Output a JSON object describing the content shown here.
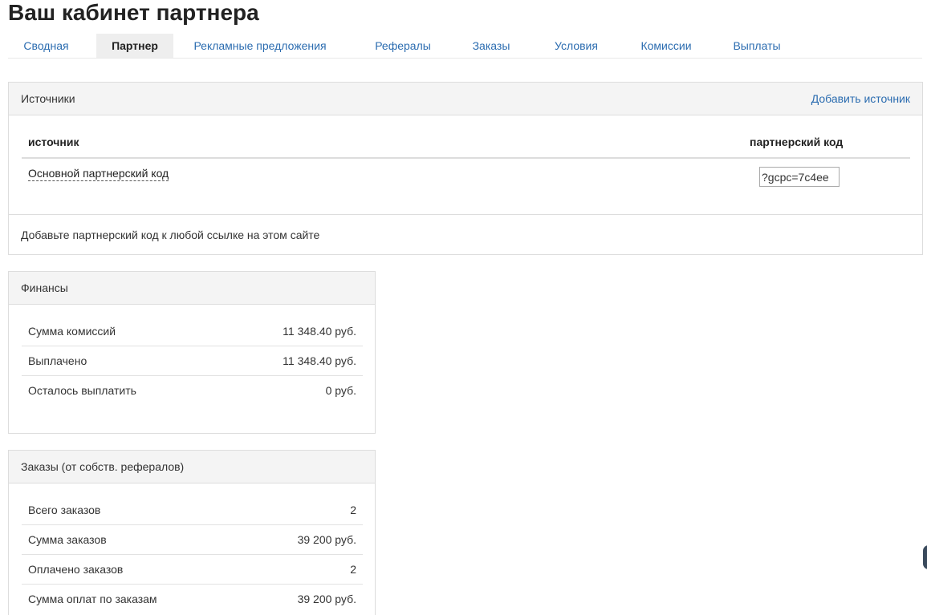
{
  "page": {
    "title": "Ваш кабинет партнера"
  },
  "tabs": [
    {
      "label": "Сводная",
      "active": false
    },
    {
      "label": "Партнер",
      "active": true
    },
    {
      "label": "Рекламные предложения",
      "active": false
    },
    {
      "label": "Рефералы",
      "active": false
    },
    {
      "label": "Заказы",
      "active": false
    },
    {
      "label": "Условия",
      "active": false
    },
    {
      "label": "Комиссии",
      "active": false
    },
    {
      "label": "Выплаты",
      "active": false
    }
  ],
  "sources": {
    "title": "Источники",
    "add_link": "Добавить источник",
    "columns": {
      "source": "источник",
      "code": "партнерский код"
    },
    "rows": [
      {
        "name": "Основной партнерский код",
        "code": "?gcpc=7c4ee"
      }
    ],
    "footer": "Добавьте партнерский код к любой ссылке на этом сайте"
  },
  "finance": {
    "title": "Финансы",
    "rows": [
      {
        "label": "Сумма комиссий",
        "value": "11 348.40 руб."
      },
      {
        "label": "Выплачено",
        "value": "11 348.40 руб."
      },
      {
        "label": "Осталось выплатить",
        "value": "0 руб."
      }
    ]
  },
  "orders": {
    "title": "Заказы (от собств. рефералов)",
    "rows": [
      {
        "label": "Всего заказов",
        "value": "2"
      },
      {
        "label": "Сумма заказов",
        "value": "39 200 руб."
      },
      {
        "label": "Оплачено заказов",
        "value": "2"
      },
      {
        "label": "Сумма оплат по заказам",
        "value": "39 200 руб."
      }
    ]
  },
  "colors": {
    "link": "#2b6cb0",
    "active_tab_bg": "#eeeeee",
    "panel_head_bg": "#f4f4f4",
    "border": "#dddddd"
  }
}
